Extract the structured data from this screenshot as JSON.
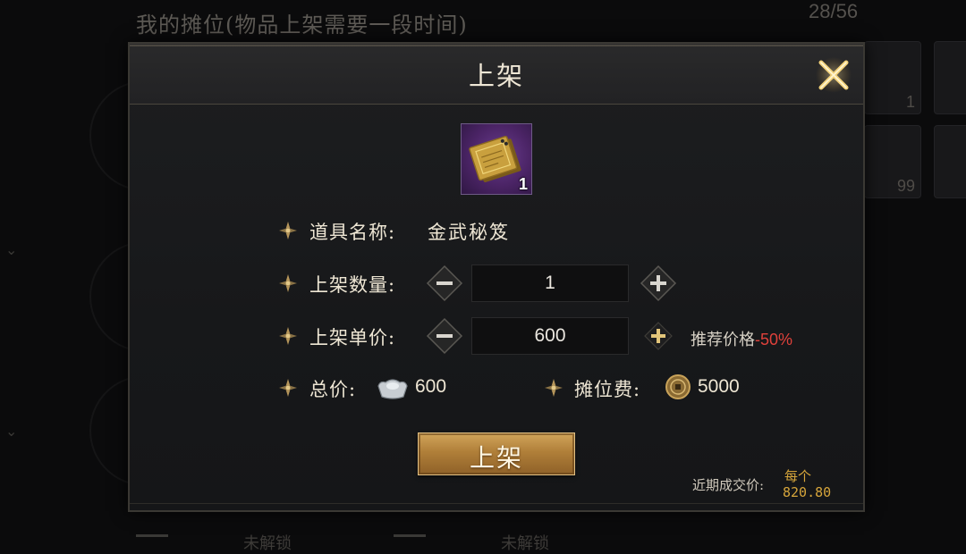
{
  "background": {
    "title": "我的摊位(物品上架需要一段时间)",
    "capacity": "28/56",
    "slot_counts": [
      "1",
      "99"
    ],
    "bottom_labels": [
      "未解锁",
      "未解锁"
    ]
  },
  "dialog": {
    "title": "上架",
    "item": {
      "icon": "golden-manual-icon",
      "count": "1"
    },
    "name_label": "道具名称:",
    "name_value": "金武秘笈",
    "quantity_label": "上架数量:",
    "quantity_value": "1",
    "price_label": "上架单价:",
    "price_value": "600",
    "recommend_label": "推荐价格",
    "recommend_pct": "-50%",
    "total_label": "总价:",
    "total_value": "600",
    "fee_label": "摊位费:",
    "fee_value": "5000",
    "confirm_label": "上架",
    "recent_label": "近期成交价:",
    "recent_each": "每个",
    "recent_value": "820.80"
  },
  "colors": {
    "accent_gold": "#d6a53b",
    "recommend_red": "#e0413b",
    "item_rarity_purple": "#4b2466"
  }
}
